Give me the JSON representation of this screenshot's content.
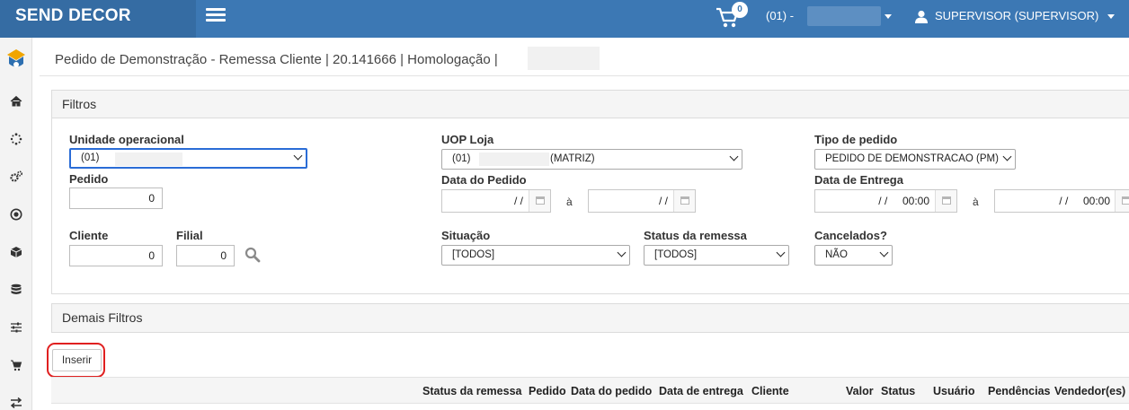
{
  "app": {
    "brand": "SEND DECOR",
    "cart_count": "0",
    "uop_selector": "(01) -",
    "user": "SUPERVISOR (SUPERVISOR)"
  },
  "sidebar": {
    "icons": [
      "logo-icon",
      "home-icon",
      "spinner-icon",
      "cogs-icon",
      "target-icon",
      "box-icon",
      "database-icon",
      "sliders-icon",
      "cart-icon",
      "exchange-icon"
    ]
  },
  "page": {
    "title": "Pedido de Demonstração - Remessa Cliente | 20.141666 | Homologação |"
  },
  "filters": {
    "heading": "Filtros",
    "unidade_label": "Unidade operacional",
    "unidade_value": "(01)",
    "uop_loja_label": "UOP Loja",
    "uop_loja_prefix": "(01)",
    "uop_loja_suffix": "(MATRIZ)",
    "tipo_label": "Tipo de pedido",
    "tipo_value": "PEDIDO DE DEMONSTRACAO (PM)",
    "pedido_label": "Pedido",
    "pedido_value": "0",
    "data_pedido_label": "Data do Pedido",
    "data_pedido_from": "/ /",
    "data_pedido_to": "/ /",
    "data_entrega_label": "Data de Entrega",
    "data_entrega_from": "/ /     00:00",
    "data_entrega_to": "/ /     00:00",
    "ate": "à",
    "cliente_label": "Cliente",
    "cliente_value": "0",
    "filial_label": "Filial",
    "filial_value": "0",
    "situacao_label": "Situação",
    "situacao_value": "[TODOS]",
    "status_label": "Status da remessa",
    "status_value": "[TODOS]",
    "cancelados_label": "Cancelados?",
    "cancelados_value": "NÃO"
  },
  "demais": {
    "heading": "Demais Filtros"
  },
  "actions": {
    "insert": "Inserir"
  },
  "table": {
    "columns": [
      "Status da remessa",
      "Pedido",
      "Data do pedido",
      "Data de entrega",
      "Cliente",
      "Valor",
      "Status",
      "Usuário",
      "Pendências",
      "Vendedor(es)"
    ]
  },
  "colors": {
    "topbar": "#3c78b4",
    "brand_bg": "#356ca3",
    "highlight": "#e02020"
  }
}
